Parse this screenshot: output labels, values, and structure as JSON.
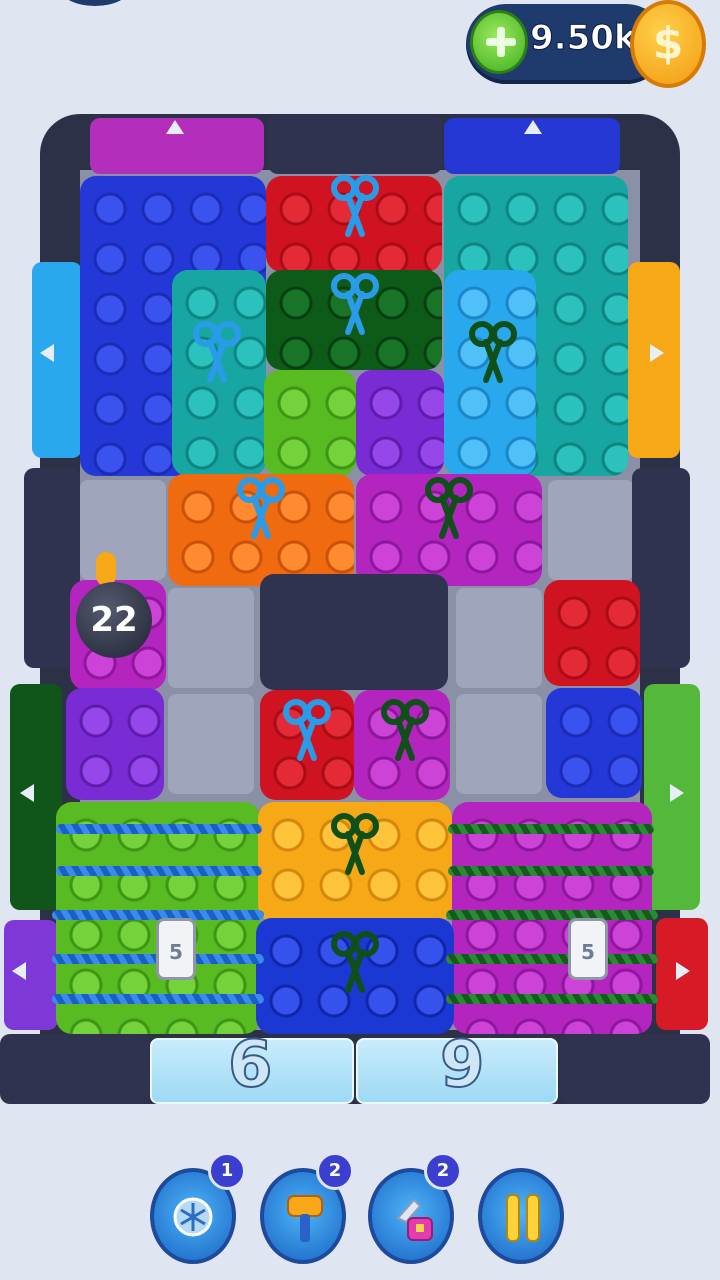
{
  "currency": {
    "amount": "9.50k",
    "coin_symbol": "$",
    "add_icon": "plus-icon"
  },
  "level": {
    "bomb_countdown": "22",
    "rope_lock_counts": [
      "5",
      "5"
    ],
    "ice_counts": [
      "6",
      "9"
    ]
  },
  "exits": {
    "arrow_icons": [
      "arrow-up-icon",
      "arrow-up-icon",
      "arrow-left-icon",
      "arrow-right-icon",
      "arrow-left-icon",
      "arrow-right-icon",
      "arrow-left-icon",
      "arrow-right-icon"
    ]
  },
  "boosters": [
    {
      "name": "freeze-booster",
      "icon": "snowflake-icon",
      "count": "1"
    },
    {
      "name": "hammer-booster",
      "icon": "hammer-icon",
      "count": "2"
    },
    {
      "name": "magnet-booster",
      "icon": "magnet-icon",
      "count": "2"
    },
    {
      "name": "pause-button",
      "icon": "pause-icon"
    }
  ],
  "colors": {
    "board": "#2d3147",
    "coin_bar": "#1f3a6c",
    "accent_yellow": "#ffd23a"
  }
}
